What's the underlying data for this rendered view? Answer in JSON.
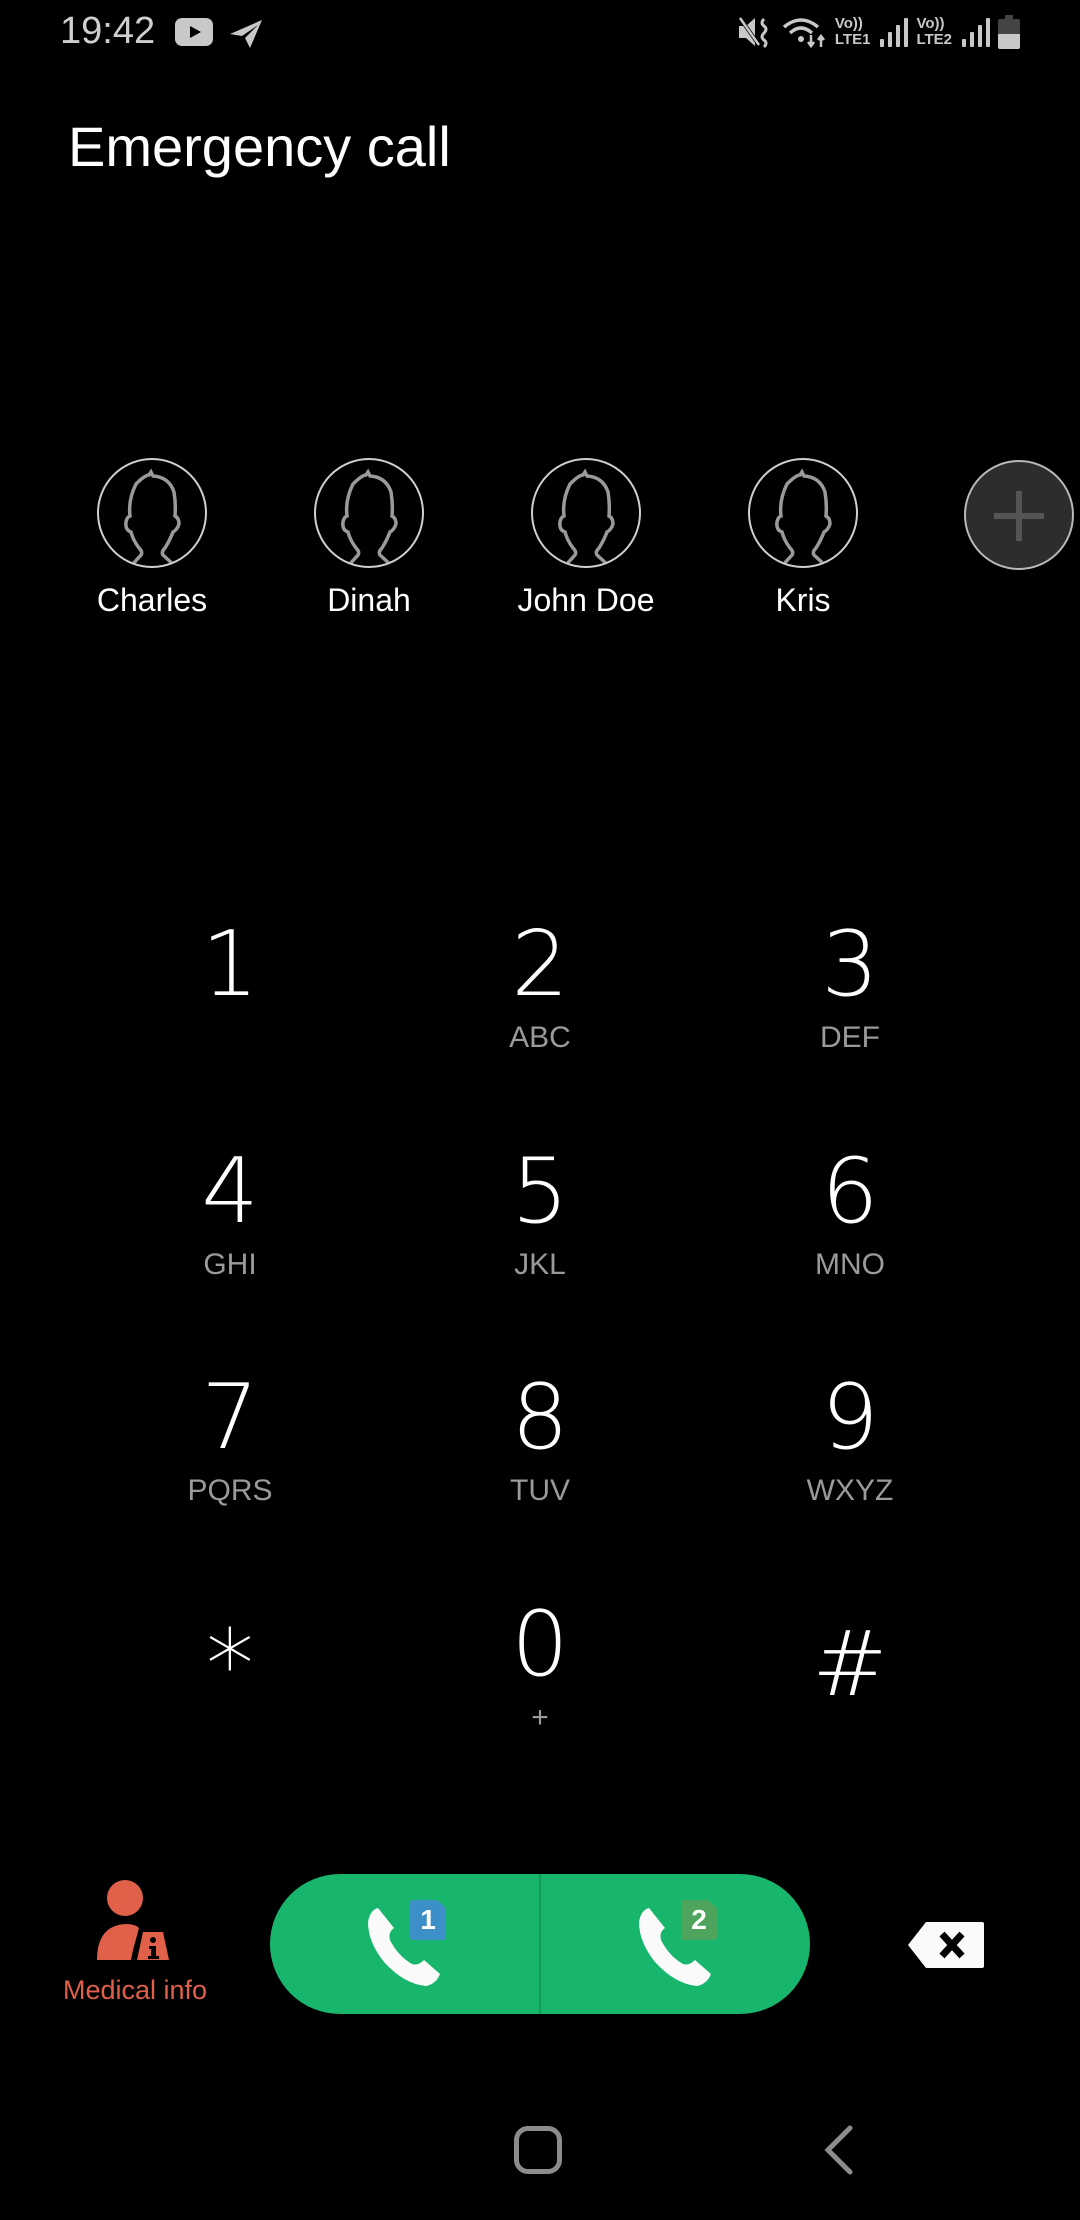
{
  "status_bar": {
    "time": "19:42",
    "notification_icons": [
      "youtube-icon",
      "telegram-icon"
    ],
    "system_icons": [
      "mute-vibrate-icon",
      "wifi-icon",
      "volte-lte1-icon",
      "signal-sim1-icon",
      "volte-lte2-icon",
      "signal-sim2-icon",
      "battery-icon"
    ],
    "volte1_top": "Vo))",
    "volte1_bottom": "LTE1",
    "volte2_top": "Vo))",
    "volte2_bottom": "LTE2",
    "battery_level": 0.5
  },
  "header": {
    "title": "Emergency call"
  },
  "emergency_contacts": [
    {
      "name": "Charles"
    },
    {
      "name": "Dinah"
    },
    {
      "name": "John Doe"
    },
    {
      "name": "Kris"
    }
  ],
  "add_contact_icon": "plus-icon",
  "keypad": [
    {
      "digit": "1",
      "letters": ""
    },
    {
      "digit": "2",
      "letters": "ABC"
    },
    {
      "digit": "3",
      "letters": "DEF"
    },
    {
      "digit": "4",
      "letters": "GHI"
    },
    {
      "digit": "5",
      "letters": "JKL"
    },
    {
      "digit": "6",
      "letters": "MNO"
    },
    {
      "digit": "7",
      "letters": "PQRS"
    },
    {
      "digit": "8",
      "letters": "TUV"
    },
    {
      "digit": "9",
      "letters": "WXYZ"
    },
    {
      "digit": "*",
      "letters": ""
    },
    {
      "digit": "0",
      "letters": "+"
    },
    {
      "digit": "#",
      "letters": ""
    }
  ],
  "actions": {
    "medical_info_label": "Medical info",
    "call_sim1_badge": "1",
    "call_sim2_badge": "2",
    "colors": {
      "call_green": "#18b66c",
      "medical_orange": "#e0604a",
      "sim1_blue": "#3d8fc7",
      "sim2_green": "#4ea35d"
    }
  },
  "nav_bar": {
    "buttons": [
      "home-icon",
      "back-icon"
    ]
  }
}
